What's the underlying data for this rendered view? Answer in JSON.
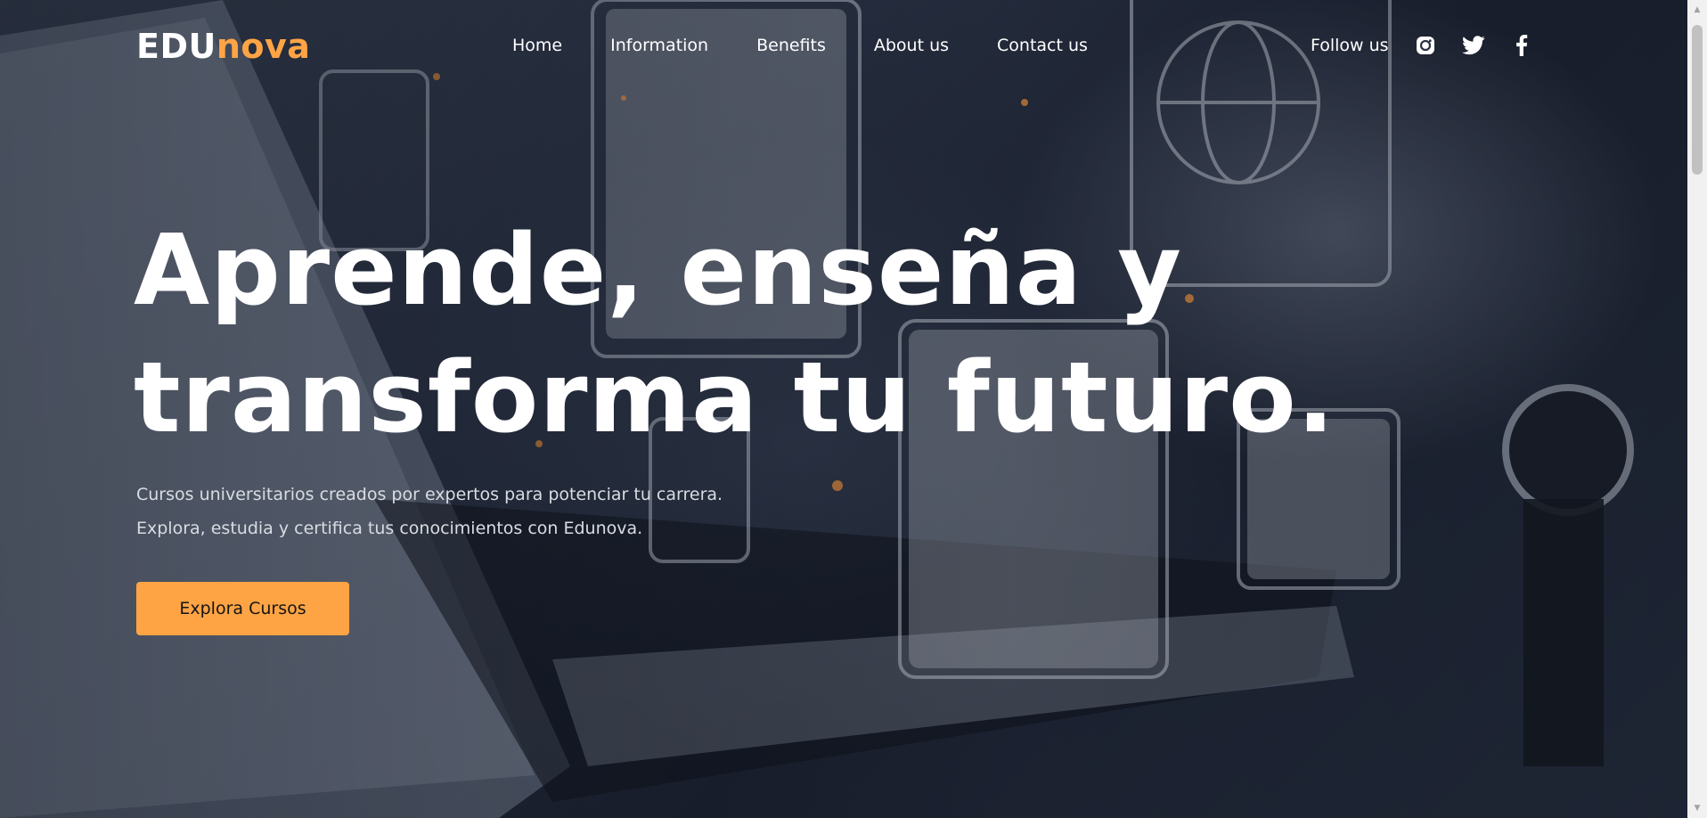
{
  "brand": {
    "logo_part1": "EDU",
    "logo_part2": "nova",
    "accent_color": "#ffa445"
  },
  "nav": {
    "items": [
      {
        "label": "Home"
      },
      {
        "label": "Information"
      },
      {
        "label": "Benefits"
      },
      {
        "label": "About us"
      },
      {
        "label": "Contact us"
      }
    ]
  },
  "social": {
    "label": "Follow us",
    "icons": [
      "instagram-icon",
      "twitter-icon",
      "facebook-icon"
    ]
  },
  "hero": {
    "headline_line1": "Aprende, enseña y",
    "headline_line2": "transforma tu futuro.",
    "subtext_line1": "Cursos universitarios creados por expertos para potenciar tu carrera.",
    "subtext_line2": "Explora, estudia y certifica tus conocimientos con Edunova.",
    "cta_label": "Explora Cursos",
    "background": "photo: hands typing on a laptop with floating translucent e-learning icons"
  }
}
